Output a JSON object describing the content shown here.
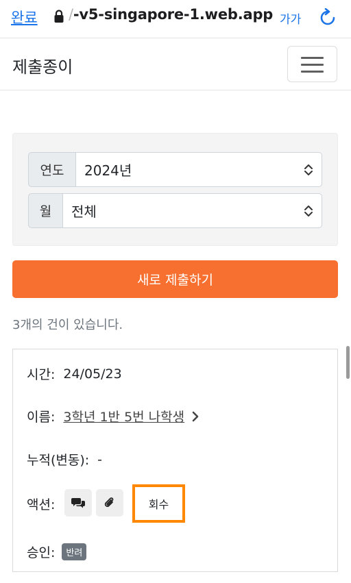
{
  "browser": {
    "done_label": "완료",
    "url_prefix": "/",
    "url_host": "-v5-singapore-1.web.app",
    "text_size_label": "가가"
  },
  "navbar": {
    "brand": "제출종이"
  },
  "filters": {
    "year_label": "연도",
    "year_value": "2024년",
    "month_label": "월",
    "month_value": "전체"
  },
  "actions": {
    "new_submit_label": "새로 제출하기"
  },
  "results": {
    "count_text": "3개의 건이 있습니다."
  },
  "item": {
    "time_label": "시간:",
    "time_value": "24/05/23",
    "name_label": "이름:",
    "name_value": "3학년 1반 5번 나학생",
    "cumulative_label": "누적(변동):",
    "cumulative_value": "-",
    "actions_label": "액션:",
    "revoke_label": "회수",
    "approval_label": "승인:",
    "approval_badge": "반려"
  },
  "colors": {
    "accent": "#f7702f",
    "link": "#1a73e8",
    "highlight": "#ff8800",
    "badge": "#6c757d"
  }
}
